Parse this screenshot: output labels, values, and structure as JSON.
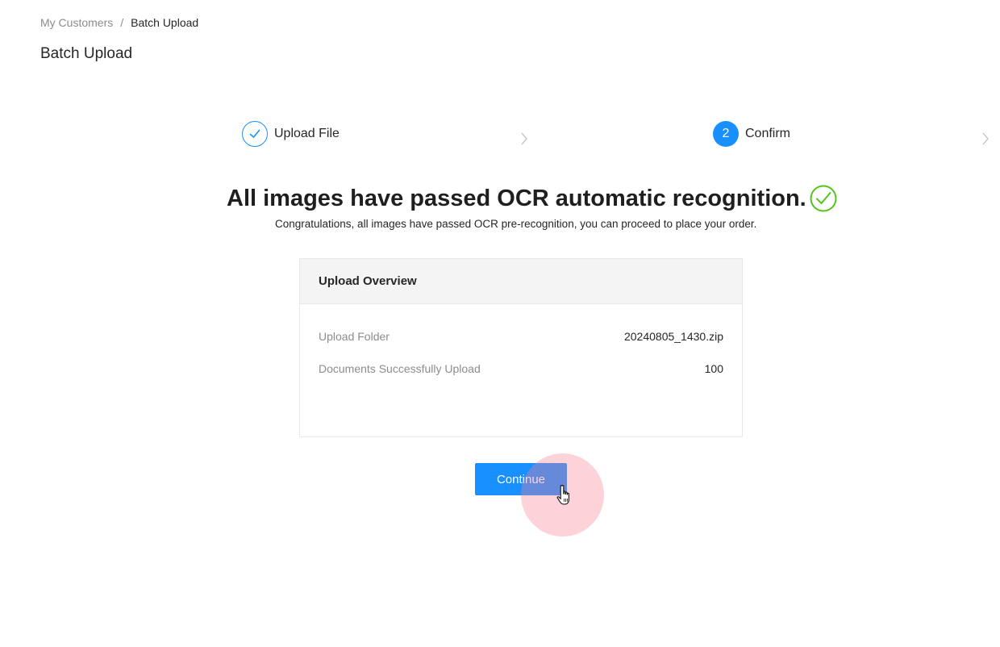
{
  "breadcrumb": {
    "parent": "My Customers",
    "separator": "/",
    "current": "Batch Upload"
  },
  "page": {
    "title": "Batch Upload"
  },
  "steps": [
    {
      "number": "1",
      "label": "Upload File",
      "status": "done"
    },
    {
      "number": "2",
      "label": "Confirm",
      "status": "active"
    }
  ],
  "result": {
    "title": "All images have passed OCR automatic recognition.",
    "subtitle": "Congratulations, all images have passed OCR pre-recognition, you can proceed to place your order."
  },
  "overview": {
    "title": "Upload Overview",
    "rows": [
      {
        "label": "Upload Folder",
        "value": "20240805_1430.zip"
      },
      {
        "label": "Documents Successfully Upload",
        "value": "100"
      }
    ]
  },
  "actions": {
    "continue_label": "Continue"
  },
  "colors": {
    "primary": "#1890ff",
    "success": "#52c41a",
    "halo": "#fa8291"
  }
}
